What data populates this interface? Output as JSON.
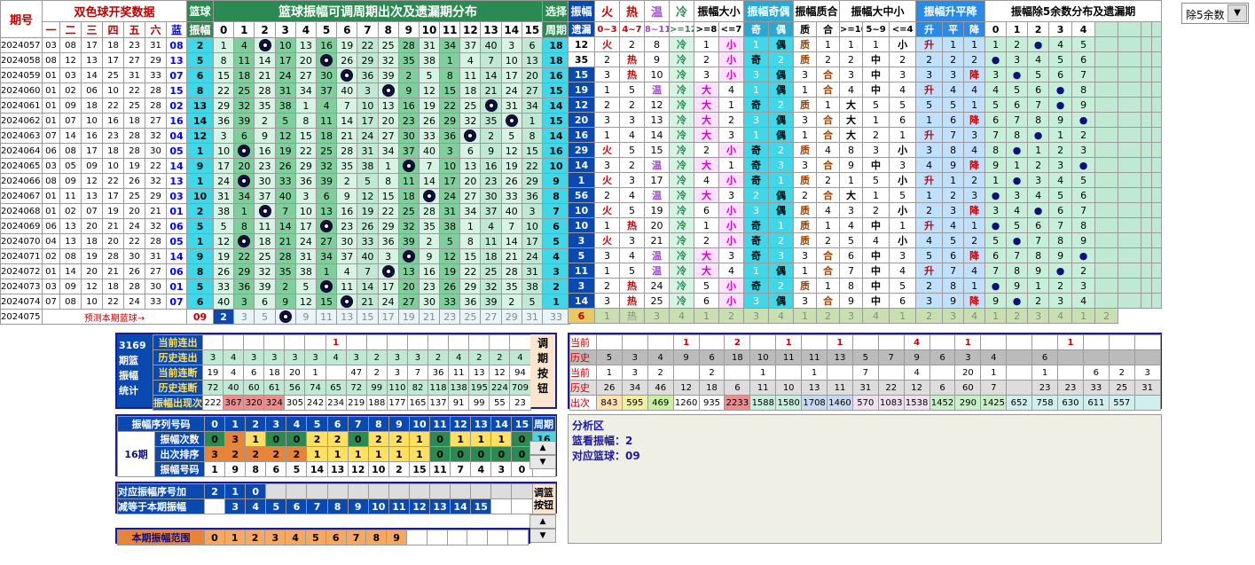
{
  "header": {
    "period": "期号",
    "ssq_title": "双色球开奖数据",
    "red_cols": [
      "一",
      "二",
      "三",
      "四",
      "五",
      "六"
    ],
    "blue_col": "蓝",
    "blue_ball": "篮球",
    "amp": "振幅",
    "main_title": "篮球振幅可调周期出次及遗漏期分布",
    "select": "选择",
    "cycle": "周期",
    "amp_cols": [
      "0",
      "1",
      "2",
      "3",
      "4",
      "5",
      "6",
      "7",
      "8",
      "9",
      "10",
      "11",
      "12",
      "13",
      "14",
      "15"
    ]
  },
  "rhead": {
    "amp": "振幅",
    "miss": "遗漏",
    "fire": "火",
    "hot": "热",
    "warm": "温",
    "cold": "冷",
    "fire_r": "0~3",
    "hot_r": "4~7",
    "warm_r": "8~11",
    "cold_r": ">=12",
    "bs": "振幅大小",
    "big_r": ">=8",
    "small_r": "<=7",
    "big": "大",
    "small": "小",
    "oe": "振幅奇偶",
    "odd": "奇",
    "even": "偶",
    "pc": "振幅质合",
    "prime": "质",
    "comp": "合",
    "bms": "振幅大中小",
    "bms1": ">=10",
    "bms2": "5~9",
    "bms3": "<=4",
    "trend": "振幅升平降",
    "up": "升",
    "flat": "平",
    "down": "降",
    "mod5": "振幅除5余数分布及遗漏期",
    "mod_cols": [
      "0",
      "1",
      "2",
      "3",
      "4"
    ]
  },
  "dropdown": {
    "value": "除5余数"
  },
  "rows": [
    {
      "p": "2024057",
      "r": [
        "03",
        "08",
        "17",
        "18",
        "23",
        "31"
      ],
      "b": "08",
      "a": "2",
      "ball": 2,
      "c": "18",
      "amp": "12"
    },
    {
      "p": "2024058",
      "r": [
        "08",
        "12",
        "13",
        "17",
        "27",
        "29"
      ],
      "b": "13",
      "a": "5",
      "ball": 5,
      "c": "18",
      "amp": "35"
    },
    {
      "p": "2024059",
      "r": [
        "01",
        "03",
        "14",
        "25",
        "31",
        "33"
      ],
      "b": "07",
      "a": "6",
      "ball": 6,
      "c": "16",
      "amp": "15"
    },
    {
      "p": "2024060",
      "r": [
        "01",
        "02",
        "06",
        "10",
        "22",
        "28"
      ],
      "b": "15",
      "a": "8",
      "ball": 8,
      "c": "15",
      "amp": "19"
    },
    {
      "p": "2024061",
      "r": [
        "01",
        "09",
        "18",
        "22",
        "25",
        "28"
      ],
      "b": "02",
      "a": "13",
      "ball": 13,
      "c": "14",
      "amp": "12"
    },
    {
      "p": "2024062",
      "r": [
        "01",
        "07",
        "10",
        "16",
        "18",
        "27"
      ],
      "b": "16",
      "a": "14",
      "ball": 14,
      "c": "15",
      "amp": "20"
    },
    {
      "p": "2024063",
      "r": [
        "07",
        "14",
        "16",
        "23",
        "28",
        "32"
      ],
      "b": "04",
      "a": "12",
      "ball": 12,
      "c": "14",
      "amp": "16"
    },
    {
      "p": "2024064",
      "r": [
        "06",
        "08",
        "17",
        "18",
        "28",
        "30"
      ],
      "b": "05",
      "a": "1",
      "ball": 1,
      "c": "16",
      "amp": "29"
    },
    {
      "p": "2024065",
      "r": [
        "03",
        "05",
        "09",
        "10",
        "19",
        "22"
      ],
      "b": "14",
      "a": "9",
      "ball": 9,
      "c": "10",
      "amp": "14"
    },
    {
      "p": "2024066",
      "r": [
        "08",
        "09",
        "12",
        "22",
        "26",
        "32"
      ],
      "b": "13",
      "a": "1",
      "ball": 1,
      "c": "9",
      "amp": "1"
    },
    {
      "p": "2024067",
      "r": [
        "01",
        "11",
        "13",
        "17",
        "25",
        "29"
      ],
      "b": "03",
      "a": "10",
      "ball": 10,
      "c": "8",
      "amp": "56"
    },
    {
      "p": "2024068",
      "r": [
        "01",
        "02",
        "07",
        "19",
        "20",
        "21"
      ],
      "b": "01",
      "a": "2",
      "ball": 2,
      "c": "7",
      "amp": "10"
    },
    {
      "p": "2024069",
      "r": [
        "06",
        "13",
        "20",
        "21",
        "24",
        "32"
      ],
      "b": "06",
      "a": "5",
      "ball": 5,
      "c": "6",
      "amp": "10"
    },
    {
      "p": "2024070",
      "r": [
        "04",
        "13",
        "18",
        "20",
        "22",
        "28"
      ],
      "b": "05",
      "a": "1",
      "ball": 1,
      "c": "5",
      "amp": "3"
    },
    {
      "p": "2024071",
      "r": [
        "02",
        "08",
        "19",
        "28",
        "30",
        "31"
      ],
      "b": "14",
      "a": "9",
      "ball": 9,
      "c": "4",
      "amp": "5"
    },
    {
      "p": "2024072",
      "r": [
        "01",
        "14",
        "20",
        "21",
        "26",
        "27"
      ],
      "b": "06",
      "a": "8",
      "ball": 8,
      "c": "3",
      "amp": "11"
    },
    {
      "p": "2024073",
      "r": [
        "03",
        "09",
        "12",
        "18",
        "28",
        "30"
      ],
      "b": "01",
      "a": "5",
      "ball": 5,
      "c": "2",
      "amp": "3"
    },
    {
      "p": "2024074",
      "r": [
        "07",
        "08",
        "10",
        "22",
        "24",
        "33"
      ],
      "b": "07",
      "a": "6",
      "ball": 6,
      "c": "1",
      "amp": "14"
    }
  ],
  "predict": {
    "p": "2024075",
    "text": "预测本期蓝球→",
    "b": "09",
    "a": "2"
  },
  "stats": {
    "title": "3169 期篮 振幅 统计",
    "labels": [
      "当前连出",
      "历史连出",
      "当前连断",
      "历史连断",
      "振幅出现次数"
    ],
    "cur_run": [
      "",
      "",
      "",
      "",
      "",
      "",
      "1",
      "",
      "",
      "",
      "",
      "",
      "",
      "",
      "",
      ""
    ],
    "hist_run": [
      "3",
      "4",
      "3",
      "3",
      "3",
      "3",
      "4",
      "3",
      "2",
      "3",
      "3",
      "2",
      "4",
      "2",
      "2",
      "4"
    ],
    "cur_miss": [
      "19",
      "4",
      "6",
      "18",
      "20",
      "1",
      "",
      "47",
      "2",
      "3",
      "7",
      "36",
      "11",
      "13",
      "12",
      "94"
    ],
    "hist_miss": [
      "72",
      "40",
      "60",
      "61",
      "56",
      "74",
      "65",
      "72",
      "99",
      "110",
      "82",
      "118",
      "138",
      "195",
      "224",
      "709"
    ],
    "count": [
      "222",
      "367",
      "320",
      "324",
      "305",
      "242",
      "234",
      "219",
      "188",
      "177",
      "165",
      "137",
      "91",
      "99",
      "55",
      "23"
    ],
    "adjust": "调 期 按 钮"
  },
  "seq": {
    "title": "振幅序列号码",
    "period": "16期",
    "labels": [
      "振幅次数",
      "出次排序",
      "振幅号码"
    ],
    "nums": [
      "0",
      "1",
      "2",
      "3",
      "4",
      "5",
      "6",
      "7",
      "8",
      "9",
      "10",
      "11",
      "12",
      "13",
      "14",
      "15"
    ],
    "times": [
      "0",
      "3",
      "1",
      "0",
      "0",
      "2",
      "2",
      "0",
      "2",
      "2",
      "1",
      "0",
      "1",
      "1",
      "1",
      "0"
    ],
    "rank": [
      "3",
      "2",
      "2",
      "2",
      "2",
      "1",
      "1",
      "1",
      "1",
      "1",
      "1",
      "0",
      "0",
      "0",
      "0",
      "0"
    ],
    "ampnum": [
      "1",
      "9",
      "8",
      "6",
      "5",
      "14",
      "13",
      "12",
      "10",
      "2",
      "15",
      "11",
      "7",
      "4",
      "3",
      "0"
    ],
    "cycle_label": "周期",
    "cycle_val": "16"
  },
  "corr": {
    "l1": "对应振幅序号加",
    "l2": "减等于本期振幅",
    "v1": [
      "2",
      "1",
      "0"
    ],
    "v2": [
      "3",
      "4",
      "5",
      "6",
      "7",
      "8",
      "9",
      "10",
      "11",
      "12",
      "13",
      "14",
      "15"
    ],
    "btn": "调篮 按钮"
  },
  "range": {
    "label": "本期振幅范围",
    "vals": [
      "0",
      "1",
      "2",
      "3",
      "4",
      "5",
      "6",
      "7",
      "8",
      "9"
    ]
  },
  "right_stats": {
    "labels": [
      "当前",
      "历史",
      "当前",
      "历史",
      "出次"
    ],
    "cur1": [
      "",
      "",
      "",
      "1",
      "",
      "2",
      "",
      "1",
      "",
      "1",
      "",
      "",
      "4",
      "",
      "1",
      "",
      "",
      "",
      "1",
      "",
      "",
      "",
      ""
    ],
    "hist1": [
      "5",
      "3",
      "4",
      "9",
      "6",
      "18",
      "10",
      "11",
      "11",
      "13",
      "5",
      "7",
      "9",
      "6",
      "3",
      "4",
      "",
      "6",
      "",
      "",
      "",
      "",
      ""
    ],
    "cur2": [
      "1",
      "3",
      "2",
      "",
      "2",
      "",
      "1",
      "",
      "1",
      "",
      "7",
      "",
      "4",
      "",
      "20",
      "1",
      "",
      "1",
      "",
      "6",
      "2",
      "3"
    ],
    "hist2": [
      "26",
      "34",
      "46",
      "12",
      "18",
      "6",
      "11",
      "10",
      "13",
      "11",
      "31",
      "22",
      "12",
      "6",
      "60",
      "7",
      "",
      "23",
      "23",
      "33",
      "25",
      "31"
    ],
    "count": [
      "843",
      "595",
      "469",
      "1260",
      "935",
      "2233",
      "1588",
      "1580",
      "1708",
      "1460",
      "570",
      "1083",
      "1538",
      "1452",
      "290",
      "1425",
      "652",
      "758",
      "630",
      "611",
      "557"
    ]
  },
  "analysis": {
    "title": "分析区",
    "l1": "篮看振幅：2",
    "l2": "对应篮球：09"
  },
  "colors": {
    "green": "#2a8a52",
    "blue_bg": "#0a4ab0",
    "cyan": "#40d8e8",
    "orange": "#e8843a",
    "navy": "#10107a"
  }
}
